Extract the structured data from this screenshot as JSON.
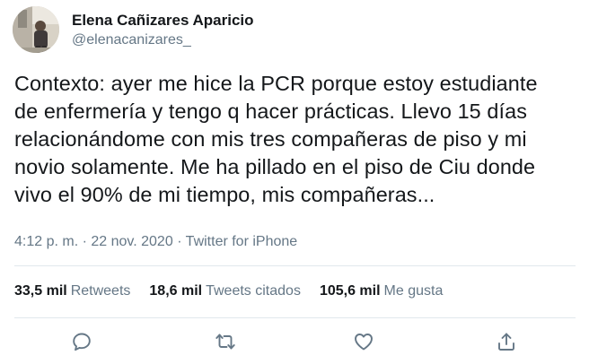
{
  "author": {
    "display_name": "Elena Cañizares Aparicio",
    "handle": "@elenacanizares_",
    "avatar_icon": "profile-photo"
  },
  "tweet": {
    "text": "Contexto: ayer me hice la PCR porque estoy estudiante\nde enfermería y tengo q hacer prácticas. Llevo 15 días\nrelacionándome con mis tres compañeras de piso y mi\nnovio solamente. Me ha pillado en el piso de Ciu donde\nvivo el 90% de mi tiempo, mis compañeras...",
    "time": "4:12 p. m.",
    "separator": "·",
    "date": "22 nov. 2020",
    "source": "Twitter for iPhone"
  },
  "stats": {
    "retweets_value": "33,5 mil",
    "retweets_label": "Retweets",
    "quotes_value": "18,6 mil",
    "quotes_label": "Tweets citados",
    "likes_value": "105,6 mil",
    "likes_label": "Me gusta"
  },
  "actions": {
    "reply_icon": "reply-icon",
    "retweet_icon": "retweet-icon",
    "like_icon": "like-icon",
    "share_icon": "share-icon"
  },
  "colors": {
    "text_primary": "#14171a",
    "text_secondary": "#657786",
    "divider": "#e1e8ed",
    "icon": "#657786"
  }
}
